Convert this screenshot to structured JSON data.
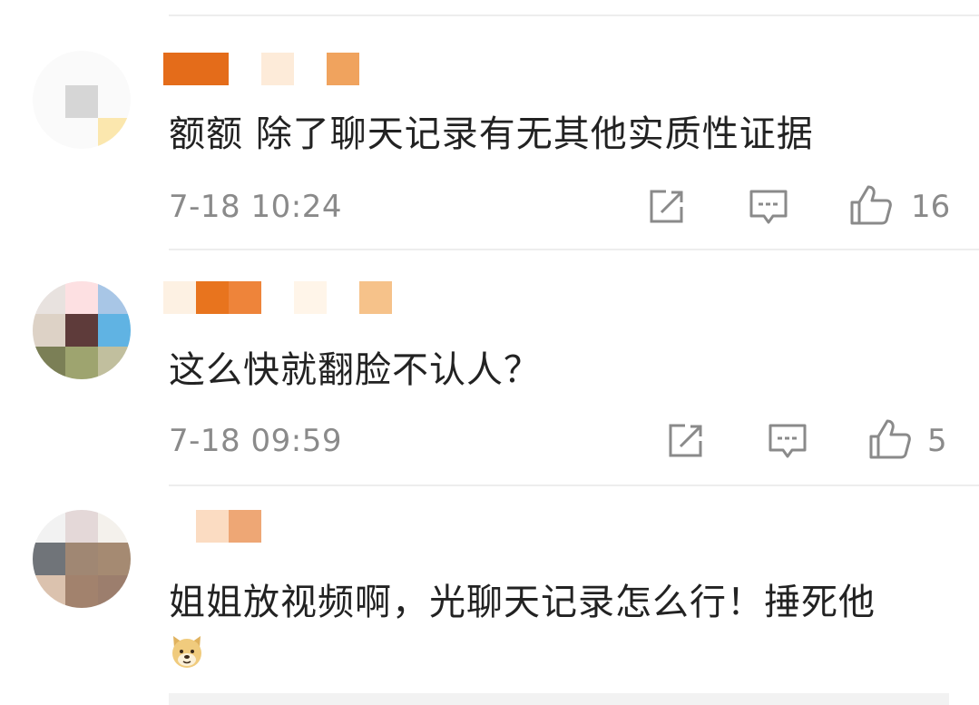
{
  "comments": [
    {
      "text": "额额 除了聊天记录有无其他实质性证据",
      "time": "7-18 10:24",
      "likes": "16"
    },
    {
      "text": "这么快就翻脸不认人？",
      "time": "7-18 09:59",
      "likes": "5"
    },
    {
      "text": "姐姐放视频啊，光聊天记录怎么行！捶死他",
      "emoji": "doge-emoji"
    }
  ],
  "icons": {
    "repost": "share-box-icon",
    "reply": "comment-bubble-icon",
    "like": "thumbs-up-icon"
  },
  "colors": {
    "text": "#222222",
    "meta": "#8a8a8a",
    "username_mosaic_primary": "#e8741e",
    "username_mosaic_secondary": "#f0a766"
  }
}
